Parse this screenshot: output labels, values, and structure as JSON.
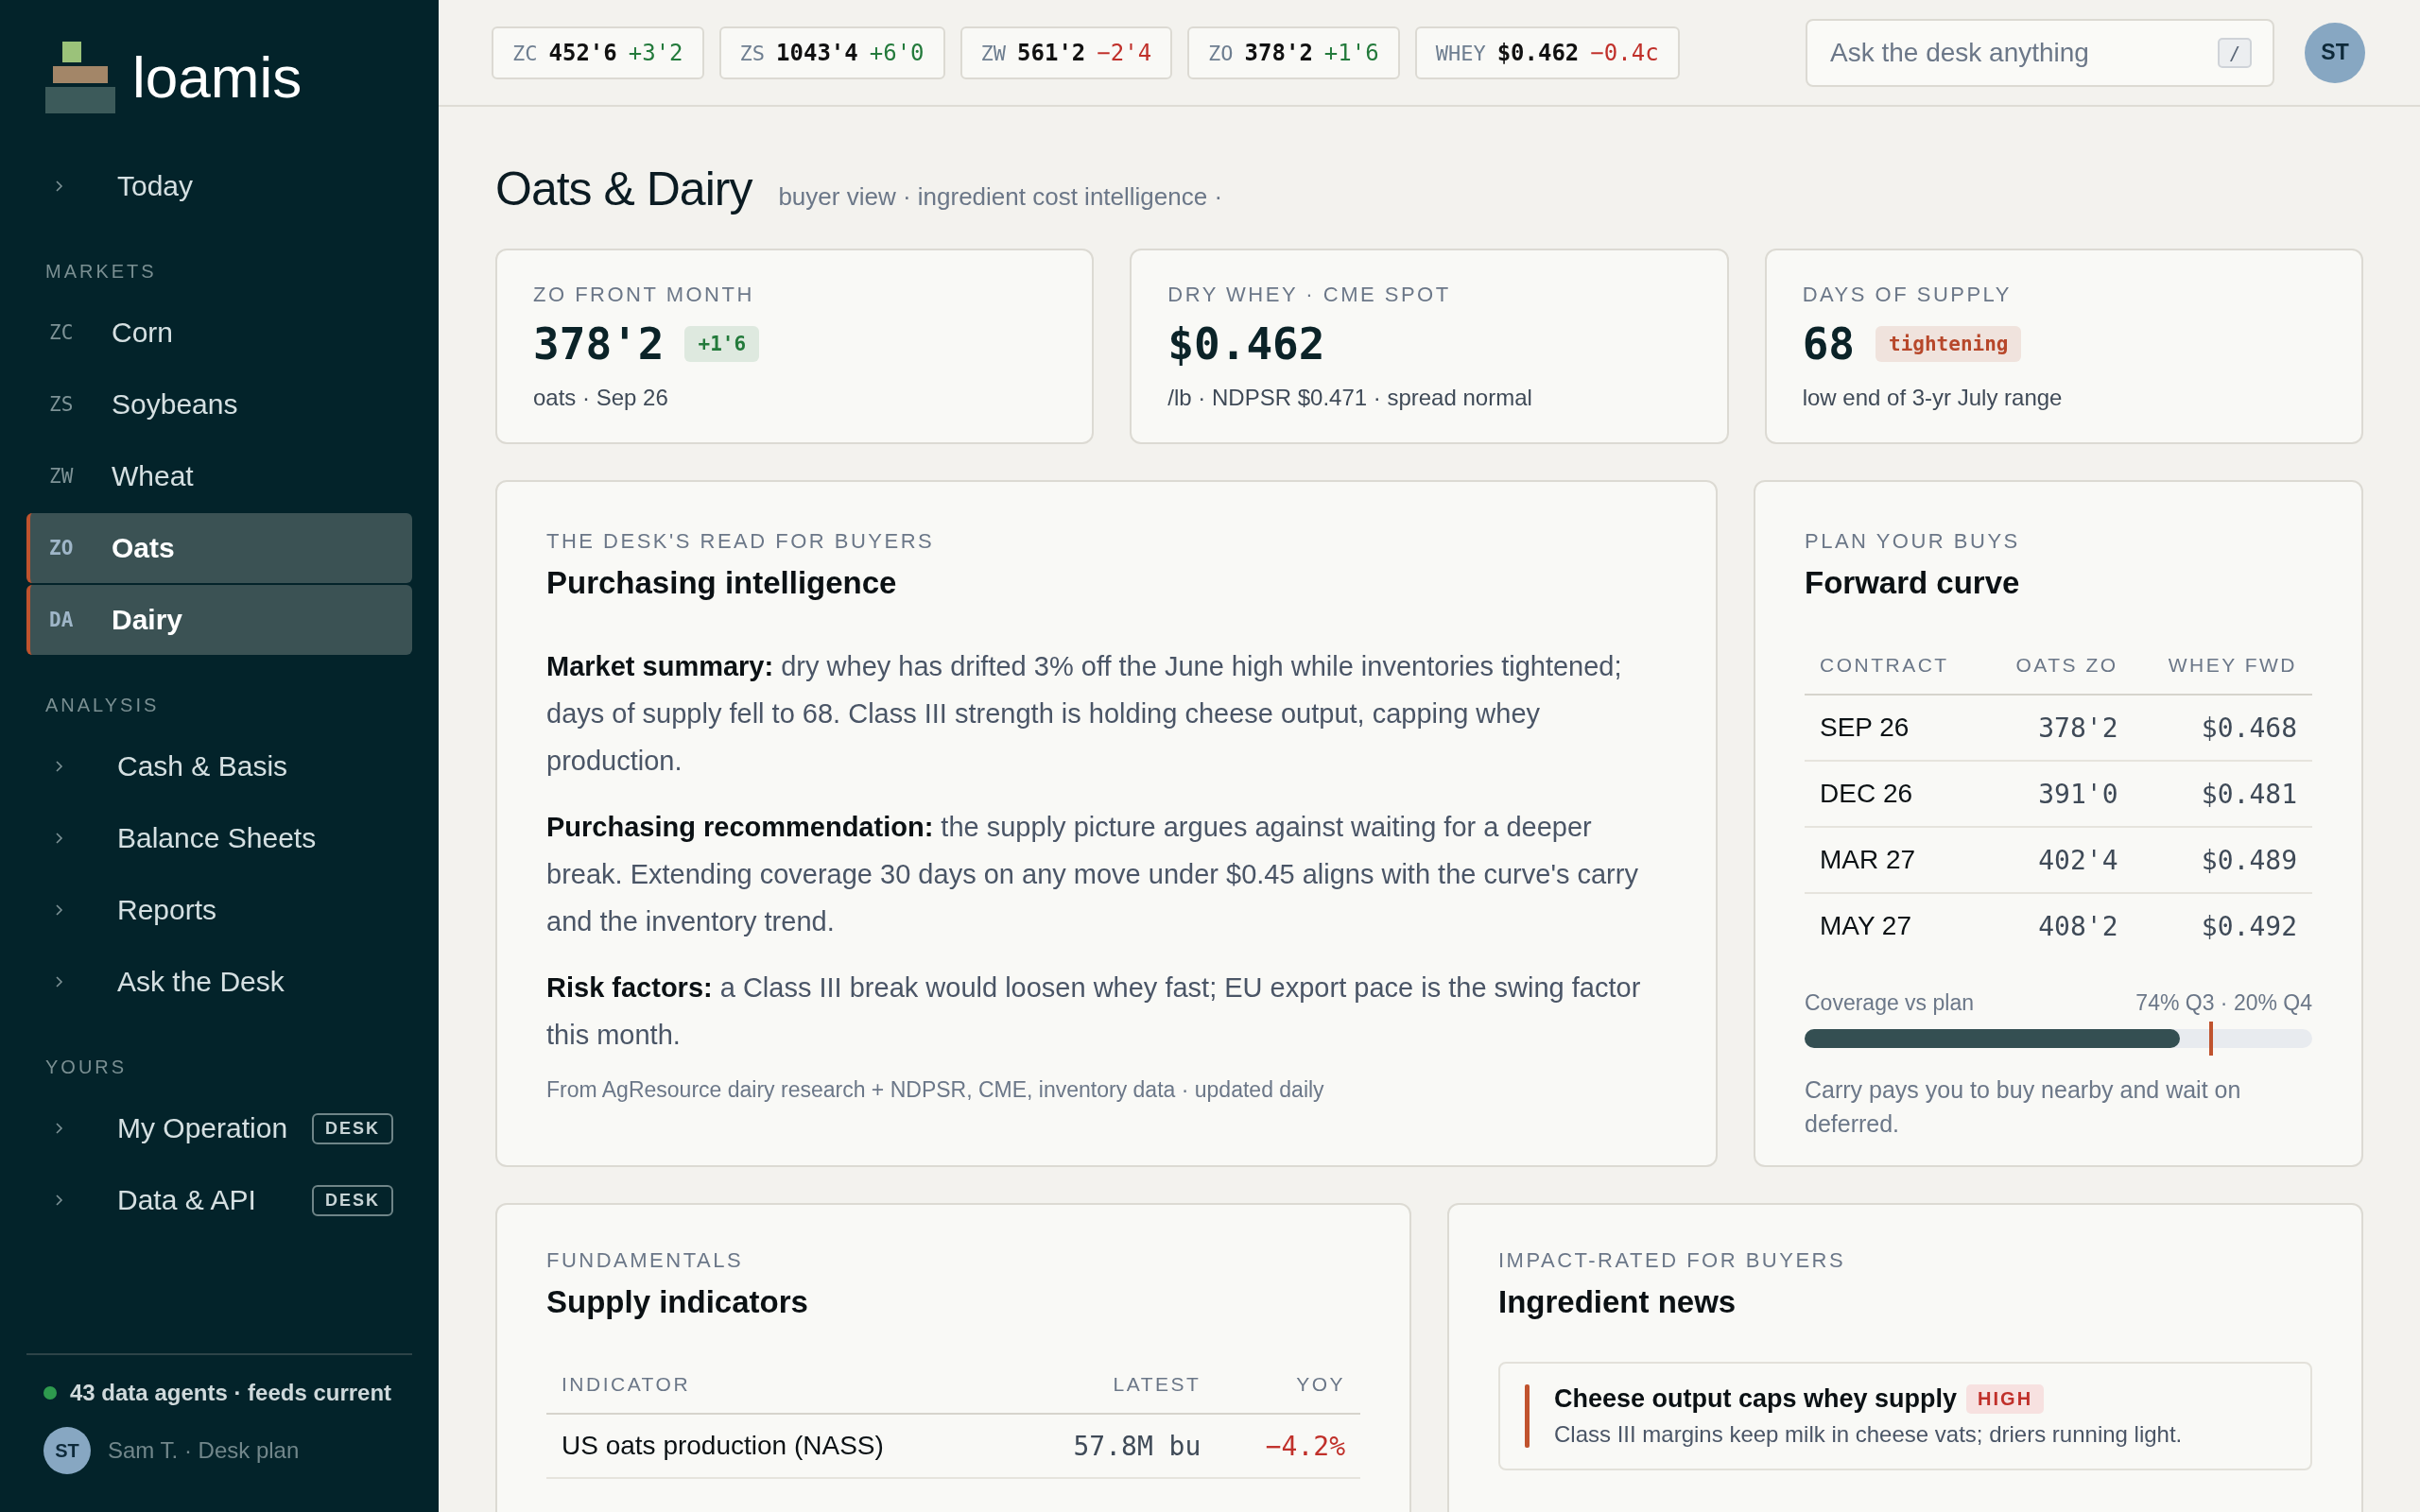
{
  "brand": {
    "name": "loamis"
  },
  "sidebar": {
    "sections": [
      {
        "items": [
          {
            "kind": "link",
            "label": "Today",
            "selected": false
          }
        ]
      },
      {
        "title": "MARKETS",
        "items": [
          {
            "kind": "market",
            "code": "ZC",
            "label": "Corn",
            "selected": false
          },
          {
            "kind": "market",
            "code": "ZS",
            "label": "Soybeans",
            "selected": false
          },
          {
            "kind": "market",
            "code": "ZW",
            "label": "Wheat",
            "selected": false
          },
          {
            "kind": "market",
            "code": "ZO",
            "label": "Oats",
            "selected": true
          },
          {
            "kind": "market",
            "code": "DA",
            "label": "Dairy",
            "selected": true
          }
        ]
      },
      {
        "title": "ANALYSIS",
        "items": [
          {
            "kind": "link",
            "label": "Cash & Basis",
            "selected": false
          },
          {
            "kind": "link",
            "label": "Balance Sheets",
            "selected": false
          },
          {
            "kind": "link",
            "label": "Reports",
            "selected": false
          },
          {
            "kind": "link",
            "label": "Ask the Desk",
            "selected": false
          }
        ]
      },
      {
        "title": "YOURS",
        "items": [
          {
            "kind": "link",
            "label": "My Operation",
            "badge": "DESK",
            "selected": false
          },
          {
            "kind": "link",
            "label": "Data & API",
            "badge": "DESK",
            "selected": false
          }
        ]
      }
    ],
    "status": {
      "text": "43 data agents · feeds current",
      "color": "#2e9a4e"
    },
    "user": {
      "initials": "ST",
      "label": "Sam T. · Desk plan"
    }
  },
  "tickers": [
    {
      "code": "ZC",
      "price": "452'6",
      "change": "+3'2",
      "color": "#237a3b"
    },
    {
      "code": "ZS",
      "price": "1043'4",
      "change": "+6'0",
      "color": "#237a3b"
    },
    {
      "code": "ZW",
      "price": "561'2",
      "change": "−2'4",
      "color": "#c0302a"
    },
    {
      "code": "ZO",
      "price": "378'2",
      "change": "+1'6",
      "color": "#237a3b"
    },
    {
      "code": "WHEY",
      "price": "$0.462",
      "change": "−0.4c",
      "color": "#c0302a"
    }
  ],
  "search": {
    "placeholder": "Ask the desk anything",
    "shortcut": "/"
  },
  "avatar": {
    "initials": "ST"
  },
  "page": {
    "title": "Oats & Dairy",
    "subtitle": "buyer view · ingredient cost intelligence ·"
  },
  "kpis": [
    {
      "label": "ZO FRONT MONTH",
      "value": "378'2",
      "tag": {
        "text": "+1'6",
        "color": "#237a3b"
      },
      "note": "oats · Sep 26"
    },
    {
      "label": "DRY WHEY · CME SPOT",
      "value": "$0.462",
      "note": "/lb · NDPSR $0.471 · spread normal"
    },
    {
      "label": "DAYS OF SUPPLY",
      "value": "68",
      "tag": {
        "text": "tightening",
        "color": "#b7472a"
      },
      "note": "low end of 3-yr July range"
    }
  ],
  "intelligence": {
    "eyebrow": "THE DESK'S READ FOR BUYERS",
    "title": "Purchasing intelligence",
    "paragraphs": [
      "**Market summary:** dry whey has drifted 3% off the June high while inventories tightened; days of supply fell to 68. Class III strength is holding cheese output, capping whey production.",
      "**Purchasing recommendation:** the supply picture argues against waiting for a deeper break. Extending coverage 30 days on any move under $0.45 aligns with the curve's carry and the inventory trend.",
      "**Risk factors:** a Class III break would loosen whey fast; EU export pace is the swing factor this month."
    ],
    "source": "From AgResource dairy research + NDPSR, CME, inventory data · updated daily"
  },
  "forward_curve": {
    "eyebrow": "PLAN YOUR BUYS",
    "title": "Forward curve",
    "columns": [
      "CONTRACT",
      "OATS ZO",
      "WHEY FWD"
    ],
    "rows": [
      [
        "SEP 26",
        "378'2",
        "$0.468"
      ],
      [
        "DEC 26",
        "391'0",
        "$0.481"
      ],
      [
        "MAR 27",
        "402'4",
        "$0.489"
      ],
      [
        "MAY 27",
        "408'2",
        "$0.492"
      ]
    ],
    "coverage": {
      "label": "Coverage vs plan",
      "reading": "74% Q3 · 20% Q4",
      "level": 0.74,
      "marker": {
        "level": 0.8
      }
    },
    "note": "Carry pays you to buy nearby and wait on deferred."
  },
  "supply": {
    "eyebrow": "FUNDAMENTALS",
    "title": "Supply indicators",
    "columns": [
      "INDICATOR",
      "LATEST",
      "YOY"
    ],
    "rows": [
      {
        "indicator": "US oats production (NASS)",
        "latest": "57.8M bu",
        "yoy": "−4.2%",
        "color": "#c0302a"
      }
    ]
  },
  "news": {
    "eyebrow": "IMPACT-RATED FOR BUYERS",
    "title": "Ingredient news",
    "items": [
      {
        "title": "Cheese output caps whey supply",
        "impact": "HIGH",
        "color": "#c0532e",
        "summary": "Class III margins keep milk in cheese vats; driers running light."
      }
    ]
  }
}
